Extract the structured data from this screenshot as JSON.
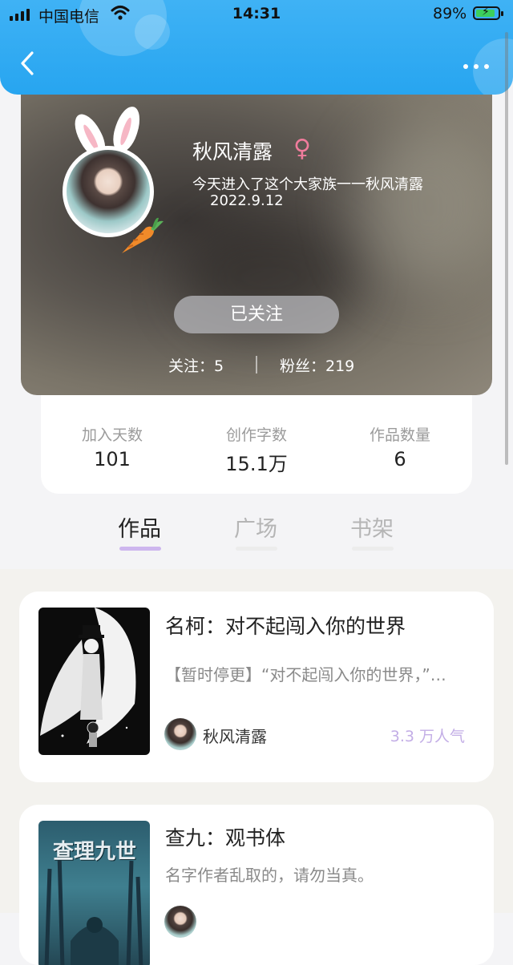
{
  "status_bar": {
    "carrier": "中国电信",
    "time": "14:31",
    "battery_percent": "89%",
    "battery_level": 0.89
  },
  "nav": {
    "back_icon": "chevron-left-icon",
    "more_icon": "more-horizontal-icon"
  },
  "profile": {
    "username": "秋风清露",
    "gender_symbol": "♀",
    "bio": "今天进入了这个大家族一一秋风清露",
    "bio_date": "2022.9.12",
    "follow_button_label": "已关注",
    "following_text": "关注：5",
    "fans_text": "粉丝：219"
  },
  "stats": [
    {
      "label": "加入天数",
      "value": "101"
    },
    {
      "label": "创作字数",
      "value": "15.1万"
    },
    {
      "label": "作品数量",
      "value": "6"
    }
  ],
  "tabs": [
    {
      "label": "作品",
      "active": true
    },
    {
      "label": "广场",
      "active": false
    },
    {
      "label": "书架",
      "active": false
    }
  ],
  "books": [
    {
      "title": "名柯：对不起闯入你的世界",
      "description": "【暂时停更】“对不起闯入你的世界，”…",
      "author": "秋风清露",
      "popularity": "3.3 万人气"
    },
    {
      "title": "查九：观书体",
      "description": "名字作者乱取的，请勿当真。",
      "cover_text": "查理九世"
    }
  ],
  "colors": {
    "header_blue": "#2ea8f2",
    "accent_purple": "#cdb6ee",
    "gender_pink": "#f07c9c"
  }
}
